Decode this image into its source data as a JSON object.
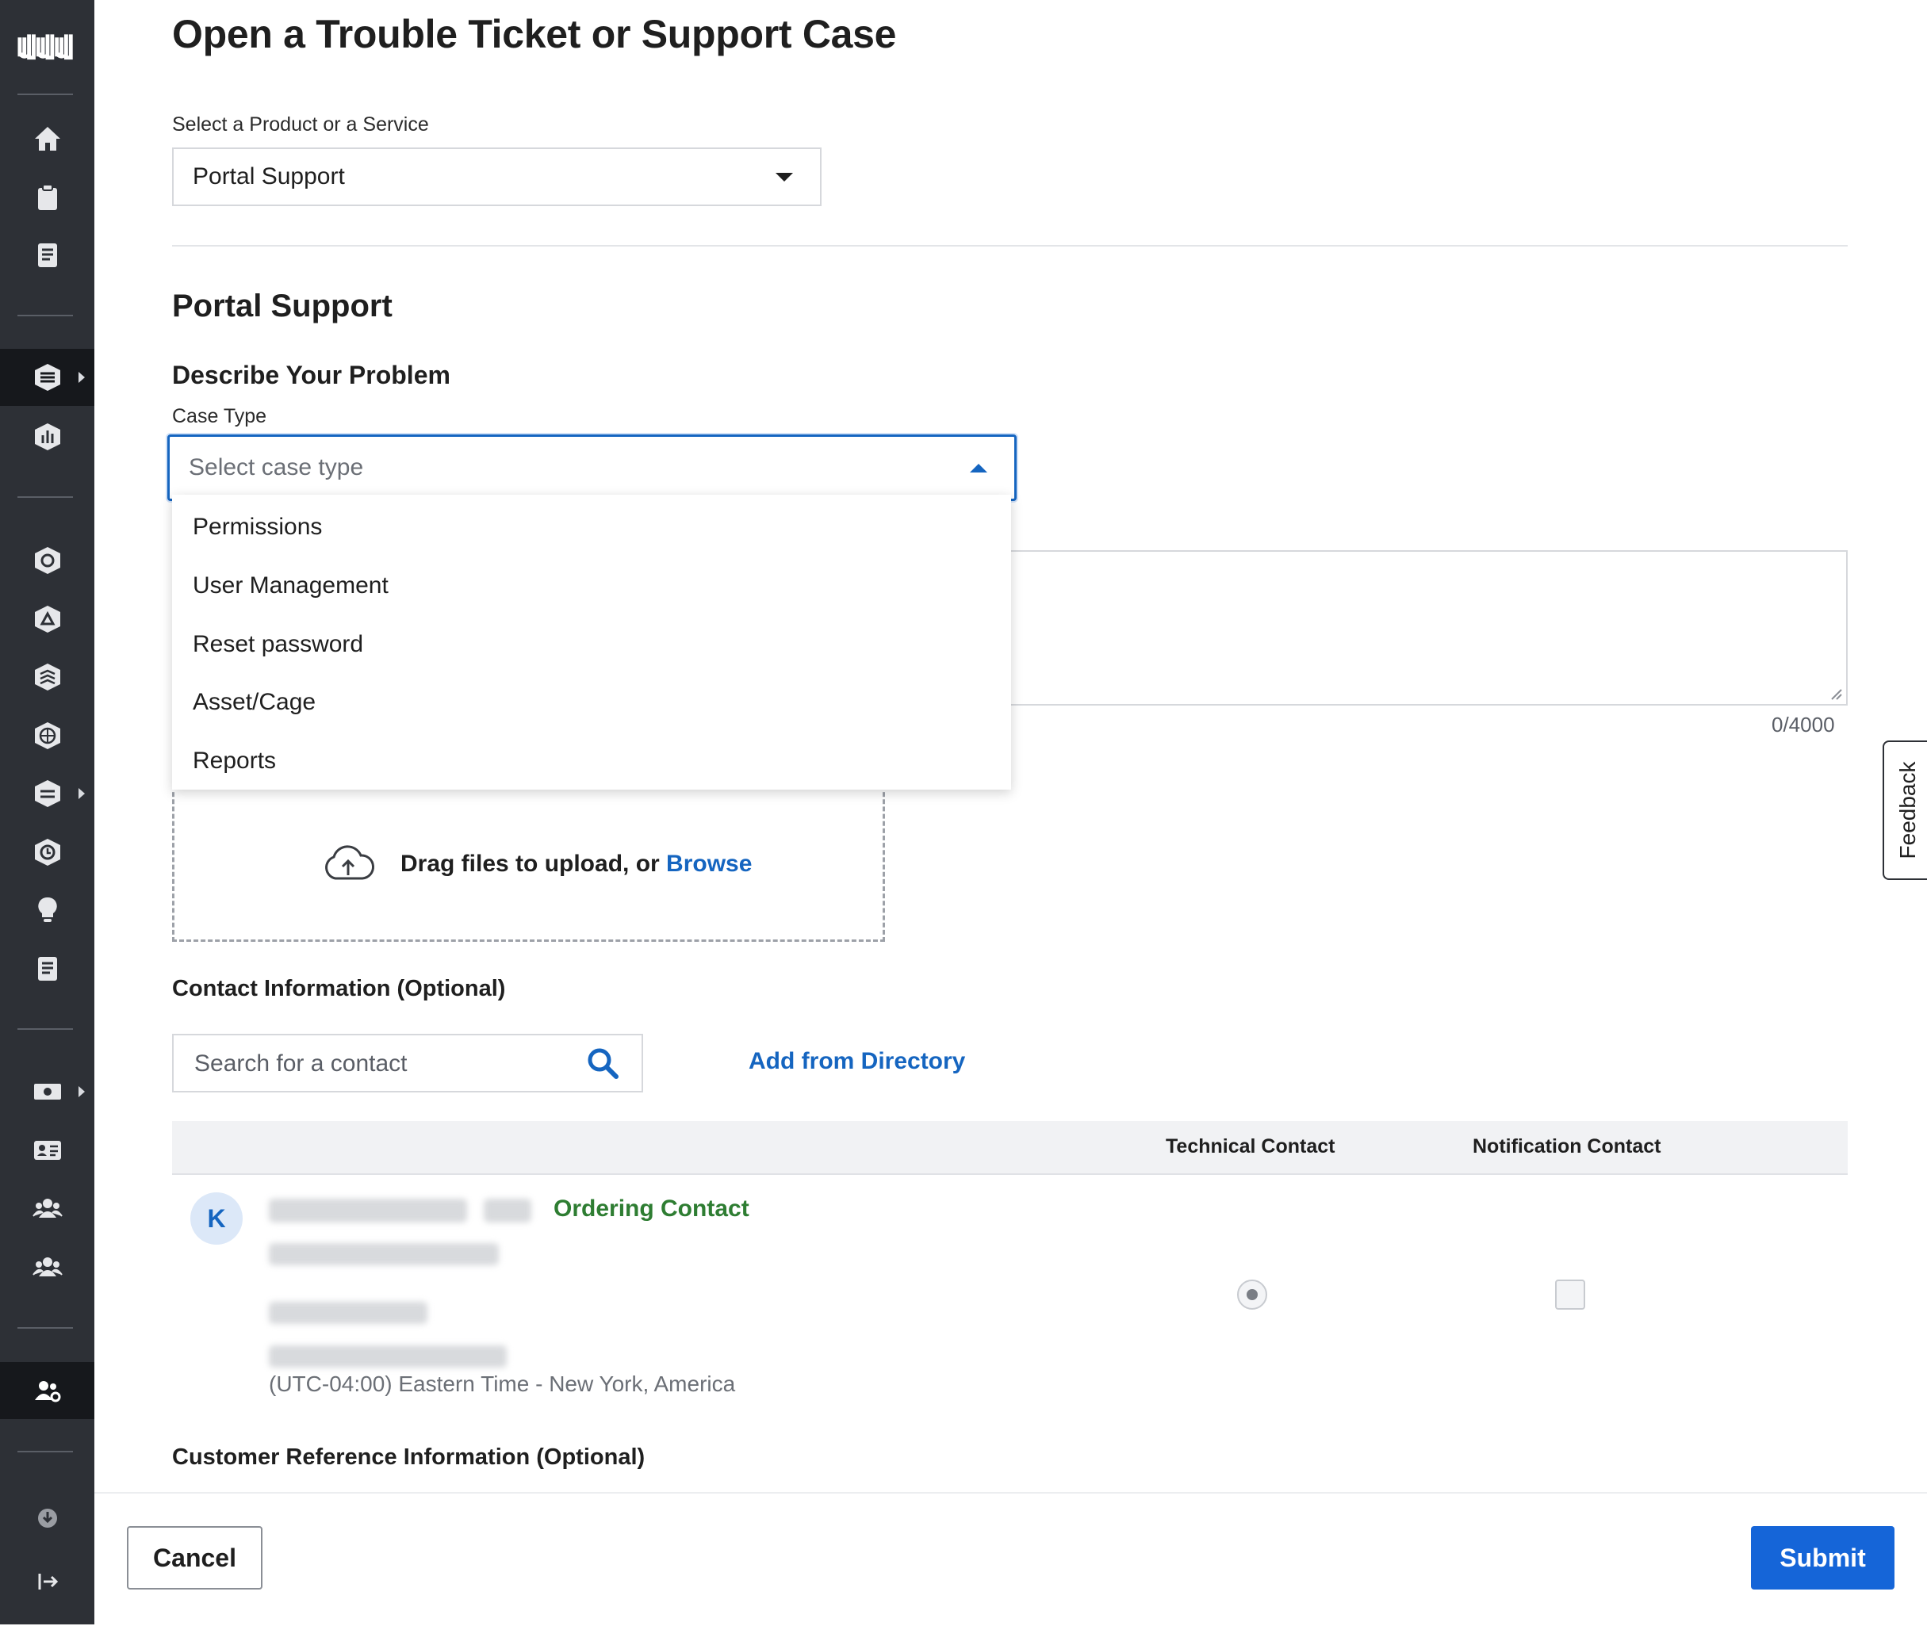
{
  "page": {
    "title": "Open a Trouble Ticket or Support Case"
  },
  "product_select": {
    "label": "Select a Product or a Service",
    "value": "Portal Support"
  },
  "section": {
    "title": "Portal Support",
    "describe_heading": "Describe Your Problem"
  },
  "case_type": {
    "label": "Case Type",
    "placeholder": "Select case type",
    "options": [
      "Permissions",
      "User Management",
      "Reset password",
      "Asset/Cage",
      "Reports"
    ]
  },
  "description": {
    "counter": "0/4000"
  },
  "upload": {
    "text": "Drag files to upload, or ",
    "browse": "Browse"
  },
  "contact": {
    "heading": "Contact Information (Optional)",
    "search_placeholder": "Search for a contact",
    "add_from_directory": "Add from Directory",
    "columns": [
      "Technical Contact",
      "Notification Contact"
    ],
    "row": {
      "avatar_initial": "K",
      "role": "Ordering Contact",
      "timezone": "(UTC-04:00) Eastern Time - New York, America",
      "technical_contact_selected": true,
      "notification_contact_checked": false
    }
  },
  "customer_reference": {
    "heading": "Customer Reference Information (Optional)"
  },
  "footer": {
    "cancel": "Cancel",
    "submit": "Submit"
  },
  "feedback_tab": "Feedback",
  "colors": {
    "sidebar": "#2d3036",
    "accent": "#1565c0",
    "submit": "#1565d8",
    "ordering_contact": "#2e7d32"
  },
  "sidebar_icons": [
    "logo-icon",
    "home-icon",
    "clipboard-icon",
    "document-icon",
    "layers-icon",
    "chart-icon",
    "network-icon",
    "fabric-icon",
    "stack-icon",
    "globe-icon",
    "exchange-icon",
    "clock-icon",
    "lightbulb-icon",
    "report-icon",
    "billing-icon",
    "id-card-icon",
    "users-icon",
    "group-icon",
    "user-settings-icon",
    "download-icon",
    "collapse-icon"
  ]
}
